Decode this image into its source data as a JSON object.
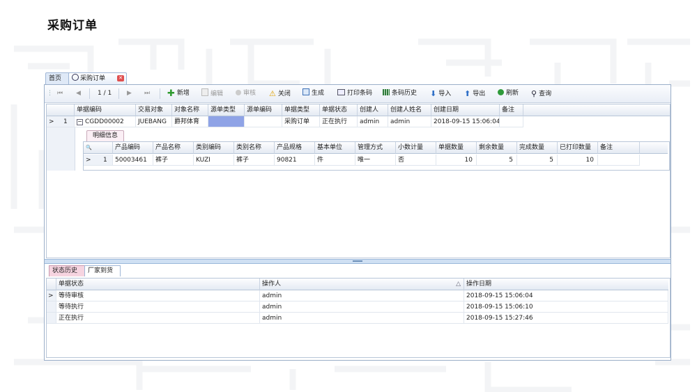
{
  "page": {
    "title": "采购订单"
  },
  "tabs": [
    {
      "label": "首页"
    },
    {
      "label": "采购订单"
    }
  ],
  "toolbar": {
    "page_indicator": "1 / 1",
    "buttons": [
      {
        "label": "新增",
        "icon": "plus-icon",
        "enabled": true
      },
      {
        "label": "编辑",
        "icon": "edit-icon",
        "enabled": false
      },
      {
        "label": "审核",
        "icon": "audit-icon",
        "enabled": false
      },
      {
        "label": "关闭",
        "icon": "warning-icon",
        "enabled": true
      },
      {
        "label": "生成",
        "icon": "generate-icon",
        "enabled": true
      },
      {
        "label": "打印条码",
        "icon": "print-icon",
        "enabled": true
      },
      {
        "label": "条码历史",
        "icon": "barcode-history-icon",
        "enabled": true
      },
      {
        "label": "导入",
        "icon": "import-icon",
        "enabled": true
      },
      {
        "label": "导出",
        "icon": "export-icon",
        "enabled": true
      },
      {
        "label": "刷新",
        "icon": "refresh-icon",
        "enabled": true
      },
      {
        "label": "查询",
        "icon": "search-icon",
        "enabled": true
      }
    ]
  },
  "main_grid": {
    "columns": [
      "单据编码",
      "交易对象",
      "对象名称",
      "源单类型",
      "源单编码",
      "单据类型",
      "单据状态",
      "创建人",
      "创建人姓名",
      "创建日期",
      "备注"
    ],
    "rows": [
      {
        "index": "1",
        "cells": [
          "CGDD00002",
          "JUEBANG",
          "爵邦体育",
          "",
          "",
          "采购订单",
          "正在执行",
          "admin",
          "admin",
          "2018-09-15 15:06:04",
          ""
        ]
      }
    ]
  },
  "detail": {
    "tab_label": "明细信息",
    "columns": [
      "产品编码",
      "产品名称",
      "类别编码",
      "类别名称",
      "产品规格",
      "基本单位",
      "管理方式",
      "小数计量",
      "单据数量",
      "剩余数量",
      "完成数量",
      "已打印数量",
      "备注"
    ],
    "rows": [
      {
        "index": "1",
        "cells": [
          "50003461",
          "裤子",
          "KUZI",
          "裤子",
          "90821",
          "件",
          "唯一",
          "否",
          "10",
          "5",
          "5",
          "10",
          ""
        ]
      }
    ]
  },
  "bottom": {
    "tabs": [
      "状态历史",
      "厂家到货"
    ],
    "columns": [
      "单据状态",
      "操作人",
      "操作日期"
    ],
    "rows": [
      [
        "等待审核",
        "admin",
        "2018-09-15 15:06:04"
      ],
      [
        "等待执行",
        "admin",
        "2018-09-15 15:06:10"
      ],
      [
        "正在执行",
        "admin",
        "2018-09-15 15:27:46"
      ]
    ]
  },
  "colors": {
    "accent": "#3b6fb6",
    "selected_cell": "#8fa3e6",
    "grid_border": "#b8c6d8"
  }
}
